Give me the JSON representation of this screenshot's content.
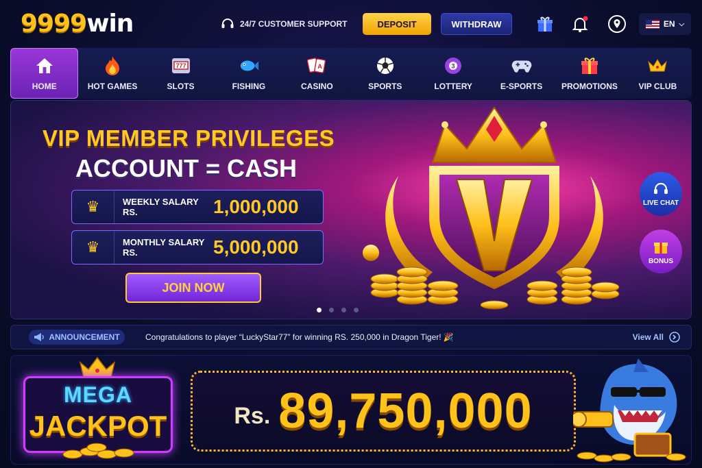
{
  "brand": {
    "logo_num": "9999",
    "logo_text": "win"
  },
  "header": {
    "support_label": "24/7 CUSTOMER SUPPORT",
    "deposit_label": "DEPOSIT",
    "withdraw_label": "WITHDRAW",
    "language": "EN"
  },
  "nav": [
    {
      "label": "HOME",
      "icon": "home-icon"
    },
    {
      "label": "HOT GAMES",
      "icon": "fire-icon"
    },
    {
      "label": "SLOTS",
      "icon": "slot-machine-icon"
    },
    {
      "label": "FISHING",
      "icon": "fish-icon"
    },
    {
      "label": "CASINO",
      "icon": "cards-icon"
    },
    {
      "label": "SPORTS",
      "icon": "soccer-ball-icon"
    },
    {
      "label": "LOTTERY",
      "icon": "lottery-ball-icon"
    },
    {
      "label": "E-SPORTS",
      "icon": "gamepad-icon"
    },
    {
      "label": "PROMOTIONS",
      "icon": "gift-icon"
    },
    {
      "label": "VIP CLUB",
      "icon": "crown-icon"
    }
  ],
  "banner": {
    "title_line1": "VIP MEMBER PRIVILEGES",
    "title_line2": "ACCOUNT = CASH",
    "weekly_label": "WEEKLY SALARY RS.",
    "weekly_amount": "1,000,000",
    "monthly_label": "MONTHLY SALARY RS.",
    "monthly_amount": "5,000,000",
    "join_label": "JOIN NOW",
    "live_chat_label": "LIVE CHAT",
    "bonus_label": "BONUS",
    "emblem_letter": "V"
  },
  "announcement": {
    "tag": "ANNOUNCEMENT",
    "text": "Congratulations to player “LuckyStar77” for winning RS. 250,000 in Dragon Tiger! 🎉",
    "view_all": "View All"
  },
  "jackpot": {
    "line1": "MEGA",
    "line2": "JACKPOT",
    "currency": "Rs.",
    "amount": "89,750,000"
  }
}
